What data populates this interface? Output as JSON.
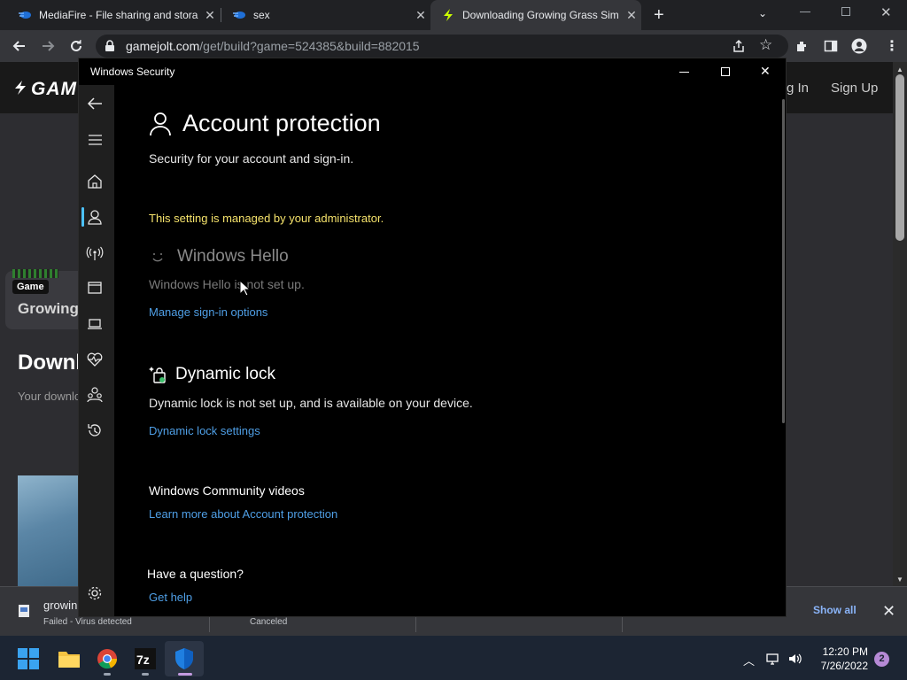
{
  "browser": {
    "tabs": [
      {
        "title": "MediaFire - File sharing and stora"
      },
      {
        "title": "sex"
      },
      {
        "title": "Downloading Growing Grass Sim"
      }
    ],
    "url_host": "gamejolt.com",
    "url_path": "/get/build?game=524385&build=882015"
  },
  "site": {
    "logo": "GAM",
    "signin": "g In",
    "signup": "Sign Up",
    "tag": "Game",
    "game_title": "Growing",
    "heading": "Downl",
    "subtext": "Your downlo"
  },
  "downloads": {
    "file_name": "growin",
    "status": "Failed - Virus detected",
    "second_status": "Canceled",
    "show_all": "Show all"
  },
  "security_window": {
    "window_title": "Windows Security",
    "title": "Account protection",
    "subtitle": "Security for your account and sign-in.",
    "admin_notice": "This setting is managed by your administrator.",
    "hello_title": "Windows Hello",
    "hello_desc": "Windows Hello is not set up.",
    "hello_link": "Manage sign-in options",
    "dynamic_title": "Dynamic lock",
    "dynamic_desc": "Dynamic lock is not set up, and is available on your device.",
    "dynamic_link": "Dynamic lock settings",
    "videos_title": "Windows Community videos",
    "videos_link": "Learn more about Account protection",
    "question_title": "Have a question?",
    "question_link": "Get help"
  },
  "taskbar": {
    "time": "12:20 PM",
    "date": "7/26/2022",
    "notification_count": "2",
    "apps": [
      "start-icon",
      "file-explorer-icon",
      "chrome-icon",
      "7zip-icon",
      "windows-security-icon"
    ]
  },
  "colors": {
    "accent": "#4cc2ff",
    "link": "#4f9fe6",
    "admin_notice": "#f5e26b"
  }
}
